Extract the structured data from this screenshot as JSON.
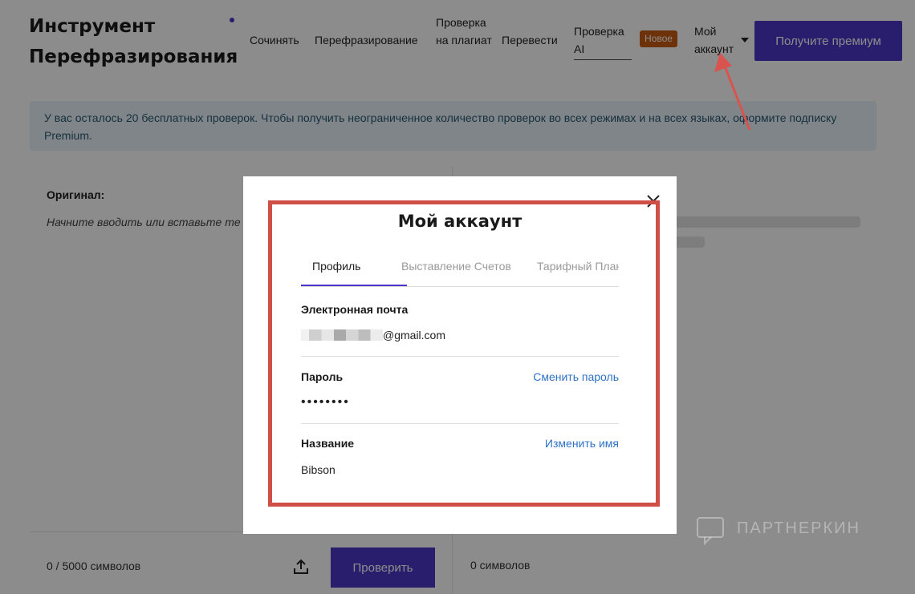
{
  "header": {
    "logo": "Инструмент Перефразирования",
    "nav": {
      "compose": "Сочинять",
      "paraphrase": "Перефразирование",
      "plagiarism": "Проверка на плагиат",
      "translate": "Перевести",
      "ai_check": "Проверка AI",
      "new_badge": "Новое",
      "account": "Мой аккаунт"
    },
    "premium_button": "Получите премиум"
  },
  "banner": {
    "text": "У вас осталось 20 бесплатных проверок. Чтобы получить неограниченное количество проверок во всех режимах и на всех языках, оформите подписку Premium."
  },
  "editor": {
    "original_label": "Оригинал:",
    "placeholder": "Начните вводить или вставьте те",
    "char_count": "0 / 5000 символов",
    "check_button": "Проверить",
    "right_char_count": "0 символов"
  },
  "modal": {
    "title": "Мой аккаунт",
    "tabs": [
      {
        "label": "Профиль",
        "active": true
      },
      {
        "label": "Выставление Счетов",
        "active": false
      },
      {
        "label": "Тарифный План",
        "active": false
      }
    ],
    "email": {
      "label": "Электронная почта",
      "value_suffix": "@gmail.com"
    },
    "password": {
      "label": "Пароль",
      "value": "••••••••",
      "action": "Сменить пароль"
    },
    "name": {
      "label": "Название",
      "value": "Bibson",
      "action": "Изменить имя"
    }
  },
  "watermark": "ПАРТНЕРКИН",
  "colors": {
    "accent": "#4b36c9",
    "badge": "#c75b12",
    "link": "#2e72c4",
    "highlight": "#cf4e46",
    "banner_bg": "#e7f3f7"
  }
}
